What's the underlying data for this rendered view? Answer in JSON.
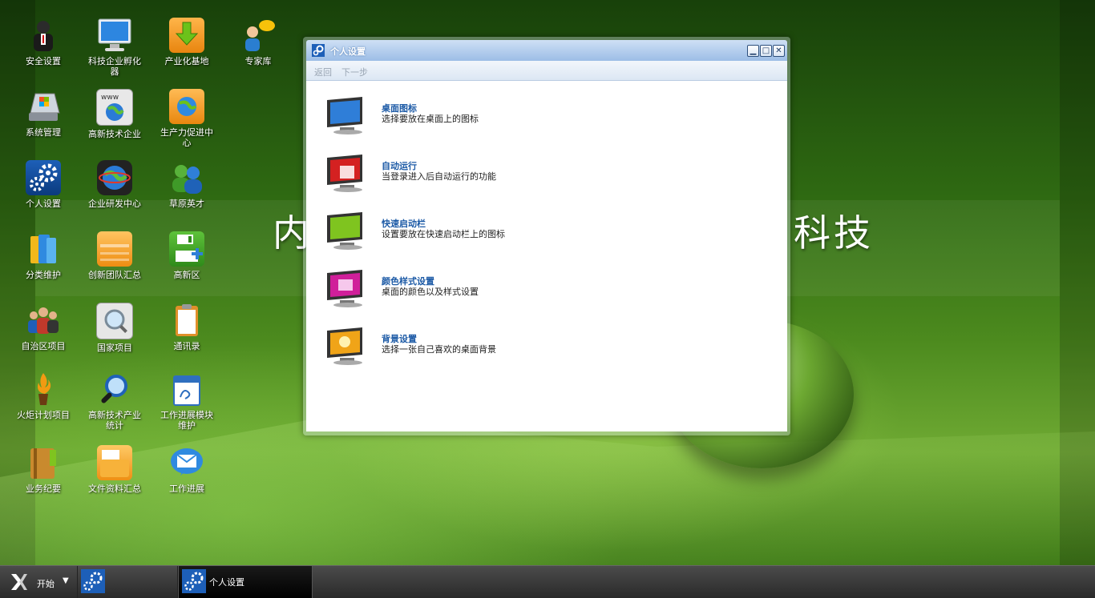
{
  "desktop": {
    "banner_left": "内",
    "banner_right": "科技",
    "icons": [
      {
        "label": "安全设置",
        "icon": "security-agent-icon"
      },
      {
        "label": "科技企业孵化器",
        "icon": "monitor-icon"
      },
      {
        "label": "产业化基地",
        "icon": "download-arrow-icon"
      },
      {
        "label": "专家库",
        "icon": "expert-chat-icon"
      },
      {
        "label": "系统管理",
        "icon": "system-drive-icon"
      },
      {
        "label": "高新技术企业",
        "icon": "www-globe-icon"
      },
      {
        "label": "生产力促进中心",
        "icon": "globe-folder-icon"
      },
      {
        "label": "个人设置",
        "icon": "gears-icon"
      },
      {
        "label": "企业研发中心",
        "icon": "globe-icon"
      },
      {
        "label": "草原英才",
        "icon": "users-icon"
      },
      {
        "label": "分类维护",
        "icon": "folders-icon"
      },
      {
        "label": "创新团队汇总",
        "icon": "orange-folder-icon"
      },
      {
        "label": "高新区",
        "icon": "save-add-icon"
      },
      {
        "label": "自治区项目",
        "icon": "group-icon"
      },
      {
        "label": "国家项目",
        "icon": "magnifier-doc-icon"
      },
      {
        "label": "通讯录",
        "icon": "clipboard-icon"
      },
      {
        "label": "火炬计划项目",
        "icon": "torch-icon"
      },
      {
        "label": "高新技术产业统计",
        "icon": "search-icon"
      },
      {
        "label": "工作进展模块维护",
        "icon": "calendar-icon"
      },
      {
        "label": "业务纪要",
        "icon": "notebook-icon"
      },
      {
        "label": "文件资料汇总",
        "icon": "file-folder-icon"
      },
      {
        "label": "工作进展",
        "icon": "mail-bubble-icon"
      }
    ]
  },
  "window": {
    "title": "个人设置",
    "toolbar": {
      "back": "返回",
      "next": "下一步"
    },
    "settings": [
      {
        "title": "桌面图标",
        "desc": "选择要放在桌面上的图标",
        "color": "#2f7ed8"
      },
      {
        "title": "自动运行",
        "desc": "当登录进入后自动运行的功能",
        "color": "#d42121"
      },
      {
        "title": "快速启动栏",
        "desc": "设置要放在快速启动栏上的图标",
        "color": "#7fc41f"
      },
      {
        "title": "颜色样式设置",
        "desc": "桌面的颜色以及样式设置",
        "color": "#d01f9a"
      },
      {
        "title": "背景设置",
        "desc": "选择一张自己喜欢的桌面背景",
        "color": "#f0a418"
      }
    ]
  },
  "taskbar": {
    "start_label": "开始",
    "task_label": "个人设置"
  }
}
